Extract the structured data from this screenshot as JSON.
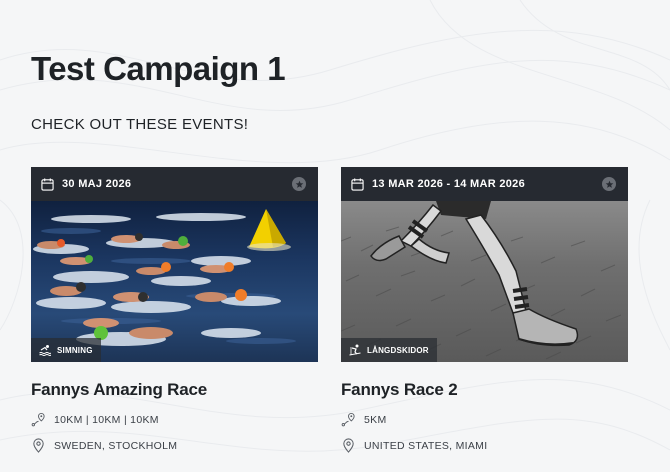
{
  "page": {
    "title": "Test Campaign 1",
    "subtitle": "CHECK OUT THESE EVENTS!"
  },
  "events": [
    {
      "date": "30 MAJ 2026",
      "sport": "SIMNING",
      "title": "Fannys Amazing Race",
      "distances": "10KM | 10KM | 10KM",
      "location": "SWEDEN, STOCKHOLM",
      "image": "open-water-swimmers-with-yellow-buoy"
    },
    {
      "date": "13 MAR 2026 - 14 MAR 2026",
      "sport": "LÅNGDSKIDOR",
      "title": "Fannys Race 2",
      "distances": "5KM",
      "location": "UNITED STATES, MIAMI",
      "image": "illustrated-runner-legs-on-grass"
    }
  ],
  "icons": {
    "date": "calendar-icon",
    "favorite": "star-icon",
    "distance": "route-pin-icon",
    "location": "map-pin-icon",
    "sport_swim": "swimming-icon",
    "sport_ski": "skiing-icon"
  },
  "colors": {
    "background": "#f5f6f7",
    "card_bar": "#262a31",
    "text": "#1e2226"
  }
}
